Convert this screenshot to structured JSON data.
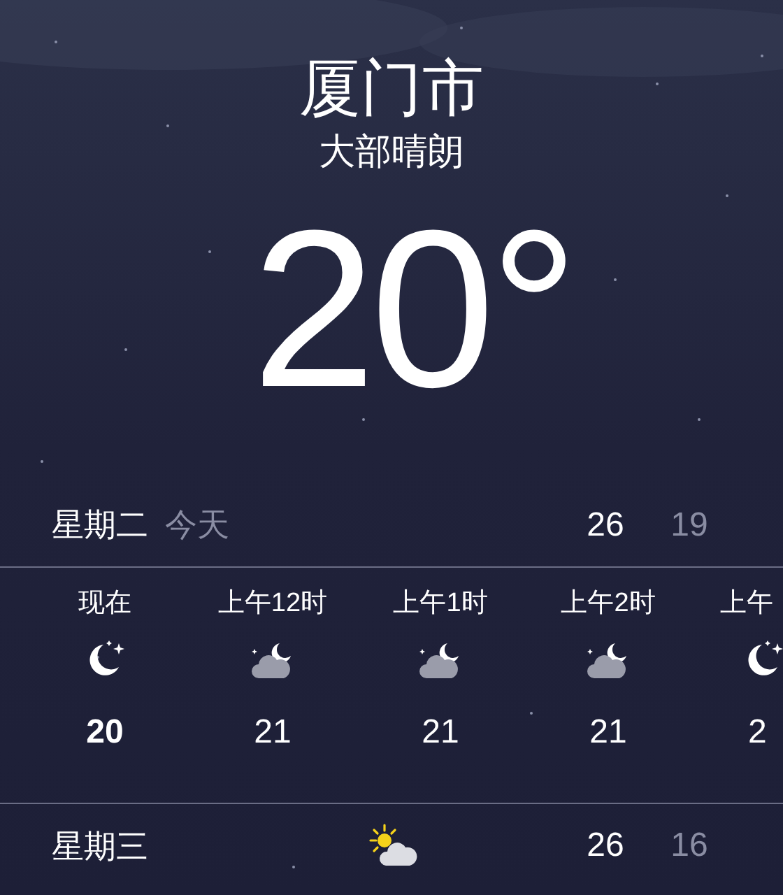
{
  "location": {
    "city": "厦门市",
    "condition": "大部晴朗",
    "temperature": "20°"
  },
  "today": {
    "day": "星期二",
    "label": "今天",
    "high": "26",
    "low": "19"
  },
  "hourly": [
    {
      "time": "现在",
      "kind": "clear_night",
      "temp": "20",
      "bold": true
    },
    {
      "time": "上午12时",
      "kind": "cloudy_night",
      "temp": "21",
      "bold": false
    },
    {
      "time": "上午1时",
      "kind": "cloudy_night",
      "temp": "21",
      "bold": false
    },
    {
      "time": "上午2时",
      "kind": "cloudy_night",
      "temp": "21",
      "bold": false
    },
    {
      "time": "上午",
      "kind": "clear_night",
      "temp": "2",
      "bold": false
    }
  ],
  "daily": [
    {
      "day": "星期三",
      "kind": "partly_sunny",
      "high": "26",
      "low": "16"
    }
  ]
}
